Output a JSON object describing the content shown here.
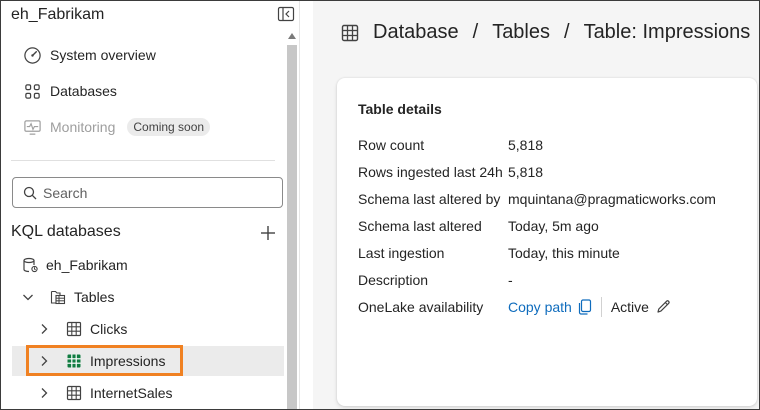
{
  "sidebar": {
    "workspace_title": "eh_Fabrikam",
    "nav": [
      {
        "label": "System overview",
        "icon": "gauge-icon",
        "disabled": false
      },
      {
        "label": "Databases",
        "icon": "grid-dots-icon",
        "disabled": false
      },
      {
        "label": "Monitoring",
        "icon": "monitor-pulse-icon",
        "disabled": true,
        "badge": "Coming soon"
      }
    ],
    "search": {
      "placeholder": "Search",
      "value": ""
    },
    "section_title": "KQL databases",
    "tree": {
      "database": "eh_Fabrikam",
      "folder": "Tables",
      "tables": [
        "Clicks",
        "Impressions",
        "InternetSales"
      ],
      "selected": "Impressions"
    }
  },
  "main": {
    "breadcrumb": [
      "Database",
      "Tables",
      "Table: Impressions"
    ],
    "card": {
      "title": "Table details",
      "rows": [
        {
          "label": "Row count",
          "value": "5,818"
        },
        {
          "label": "Rows ingested last 24h",
          "value": "5,818"
        },
        {
          "label": "Schema last altered by",
          "value": "mquintana@pragmaticworks.com"
        },
        {
          "label": "Schema last altered",
          "value": "Today, 5m ago"
        },
        {
          "label": "Last ingestion",
          "value": "Today, this minute"
        },
        {
          "label": "Description",
          "value": "-"
        }
      ],
      "onelake": {
        "label": "OneLake availability",
        "copy_label": "Copy path",
        "status": "Active"
      }
    }
  },
  "colors": {
    "accent_link": "#0f6cbd",
    "highlight_border": "#f08122",
    "selected_row_bg": "#ebebeb",
    "table_icon_active": "#107c41"
  }
}
